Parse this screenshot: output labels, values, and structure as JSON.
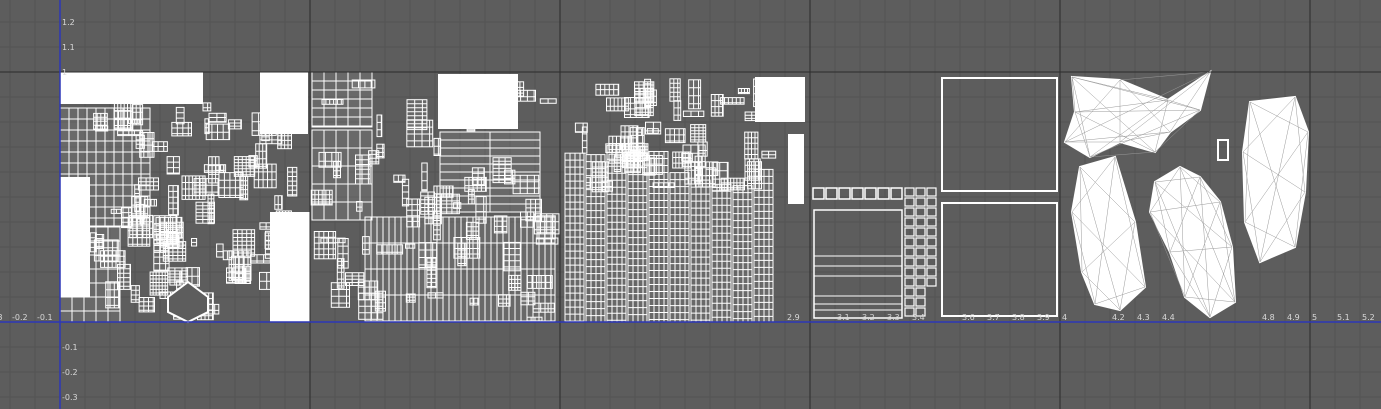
{
  "editor": {
    "panel": "UV Texture Editor",
    "colors": {
      "background": "#5d5d5d",
      "grid_minor": "#545454",
      "grid_major": "#2b2b2b",
      "axis": "#2d37b8",
      "uv_shell": "#ffffff",
      "tick_label": "#d8d8d8"
    }
  },
  "axes": {
    "u_ticks": [
      {
        "value": -0.3,
        "label": "-0.3"
      },
      {
        "value": -0.2,
        "label": "-0.2"
      },
      {
        "value": -0.1,
        "label": "-0.1"
      },
      {
        "value": 2.9,
        "label": "2.9"
      },
      {
        "value": 3.1,
        "label": "3.1"
      },
      {
        "value": 3.2,
        "label": "3.2"
      },
      {
        "value": 3.3,
        "label": "3.3"
      },
      {
        "value": 3.4,
        "label": "3.4"
      },
      {
        "value": 3.6,
        "label": "3.6"
      },
      {
        "value": 3.7,
        "label": "3.7"
      },
      {
        "value": 3.8,
        "label": "3.8"
      },
      {
        "value": 3.9,
        "label": "3.9"
      },
      {
        "value": 4.0,
        "label": "4"
      },
      {
        "value": 4.2,
        "label": "4.2"
      },
      {
        "value": 4.3,
        "label": "4.3"
      },
      {
        "value": 4.4,
        "label": "4.4"
      },
      {
        "value": 4.8,
        "label": "4.8"
      },
      {
        "value": 4.9,
        "label": "4.9"
      },
      {
        "value": 5.0,
        "label": "5"
      },
      {
        "value": 5.1,
        "label": "5.1"
      },
      {
        "value": 5.2,
        "label": "5.2"
      }
    ],
    "v_ticks": [
      {
        "value": 1.2,
        "label": "1.2"
      },
      {
        "value": 1.1,
        "label": "1.1"
      },
      {
        "value": 1.0,
        "label": "1"
      },
      {
        "value": -0.1,
        "label": "-0.1"
      },
      {
        "value": -0.2,
        "label": "-0.2"
      },
      {
        "value": -0.3,
        "label": "-0.3"
      }
    ]
  },
  "uv_tiles": [
    {
      "u": 0,
      "name": "tile-0",
      "style": "dense"
    },
    {
      "u": 1,
      "name": "tile-1",
      "style": "mixed"
    },
    {
      "u": 2,
      "name": "tile-2",
      "style": "columns"
    },
    {
      "u": 3,
      "name": "tile-3",
      "style": "squares"
    },
    {
      "u": 4,
      "name": "tile-4",
      "style": "organic"
    }
  ]
}
